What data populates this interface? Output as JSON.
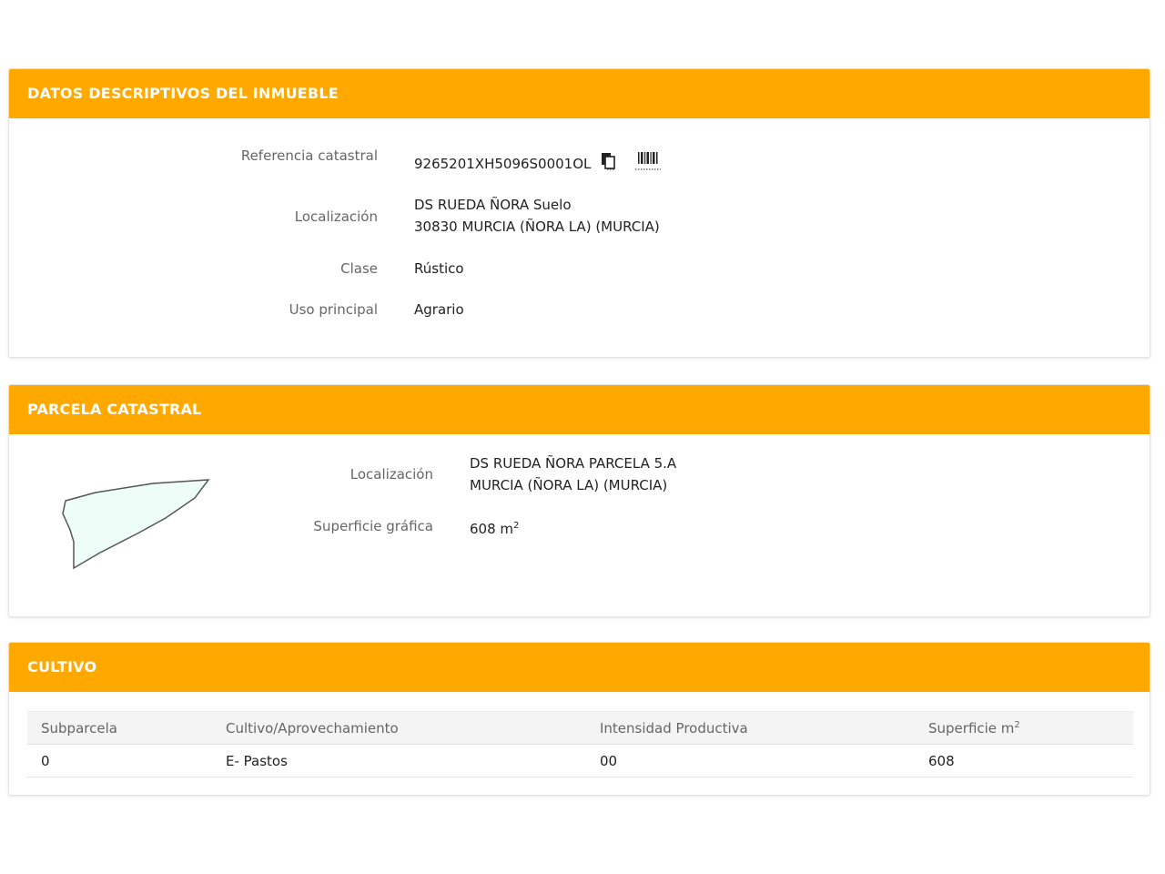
{
  "inmueble": {
    "header": "DATOS DESCRIPTIVOS DEL INMUEBLE",
    "referencia_label": "Referencia catastral",
    "referencia_value": "9265201XH5096S0001OL",
    "localizacion_label": "Localización",
    "localizacion_line1": "DS RUEDA ÑORA Suelo",
    "localizacion_line2": "30830 MURCIA (ÑORA LA) (MURCIA)",
    "clase_label": "Clase",
    "clase_value": "Rústico",
    "uso_label": "Uso principal",
    "uso_value": "Agrario"
  },
  "parcela": {
    "header": "PARCELA CATASTRAL",
    "localizacion_label": "Localización",
    "localizacion_line1": "DS RUEDA ÑORA PARCELA 5.A",
    "localizacion_line2": "MURCIA (ÑORA LA) (MURCIA)",
    "superficie_label": "Superficie gráfica",
    "superficie_value": "608 m",
    "superficie_sup": "2",
    "shape_fill": "#EEFDF7",
    "shape_stroke": "#555555"
  },
  "cultivo": {
    "header": "CULTIVO",
    "columns": [
      "Subparcela",
      "Cultivo/Aprovechamiento",
      "Intensidad Productiva",
      "Superficie m"
    ],
    "column_sup": "2",
    "rows": [
      [
        "0",
        "E- Pastos",
        "00",
        "608"
      ]
    ]
  },
  "colors": {
    "header_bg": "#FFA800",
    "header_text": "#FFFFFF",
    "label_text": "#666666"
  },
  "icons": [
    "copy-icon",
    "barcode-icon"
  ]
}
